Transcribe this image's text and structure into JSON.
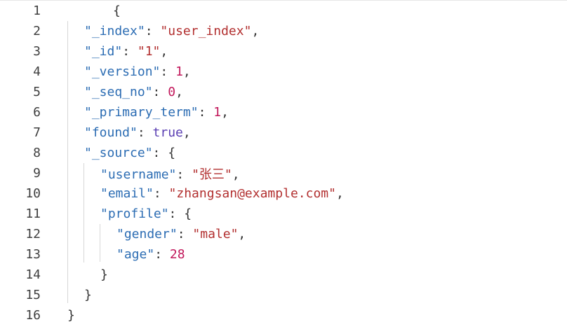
{
  "editor": {
    "lines": [
      {
        "n": "1",
        "t": "{"
      },
      {
        "n": "2",
        "t": "\"_index\": \"user_index\","
      },
      {
        "n": "3",
        "t": "\"_id\": \"1\","
      },
      {
        "n": "4",
        "t": "\"_version\": 1,"
      },
      {
        "n": "5",
        "t": "\"_seq_no\": 0,"
      },
      {
        "n": "6",
        "t": "\"_primary_term\": 1,"
      },
      {
        "n": "7",
        "t": "\"found\": true,"
      },
      {
        "n": "8",
        "t": "\"_source\": {"
      },
      {
        "n": "9",
        "t": "\"username\": \"张三\","
      },
      {
        "n": "10",
        "t": "\"email\": \"zhangsan@example.com\","
      },
      {
        "n": "11",
        "t": "\"profile\": {"
      },
      {
        "n": "12",
        "t": "\"gender\": \"male\","
      },
      {
        "n": "13",
        "t": "\"age\": 28"
      },
      {
        "n": "14",
        "t": "}"
      },
      {
        "n": "15",
        "t": "}"
      },
      {
        "n": "16",
        "t": "}"
      }
    ],
    "colors": {
      "key": "#2b6cb3",
      "string": "#b22f2f",
      "number": "#c2185b",
      "boolean": "#5b3fb3"
    }
  },
  "tokens": {
    "l1": {
      "open": "{"
    },
    "l2": {
      "k": "\"_index\"",
      "colon": ": ",
      "v": "\"user_index\"",
      "comma": ","
    },
    "l3": {
      "k": "\"_id\"",
      "colon": ": ",
      "v": "\"1\"",
      "comma": ","
    },
    "l4": {
      "k": "\"_version\"",
      "colon": ": ",
      "v": "1",
      "comma": ","
    },
    "l5": {
      "k": "\"_seq_no\"",
      "colon": ": ",
      "v": "0",
      "comma": ","
    },
    "l6": {
      "k": "\"_primary_term\"",
      "colon": ": ",
      "v": "1",
      "comma": ","
    },
    "l7": {
      "k": "\"found\"",
      "colon": ": ",
      "v": "true",
      "comma": ","
    },
    "l8": {
      "k": "\"_source\"",
      "colon": ": ",
      "v": "{"
    },
    "l9": {
      "k": "\"username\"",
      "colon": ": ",
      "v": "\"张三\"",
      "comma": ","
    },
    "l10": {
      "k": "\"email\"",
      "colon": ": ",
      "v": "\"zhangsan@example.com\"",
      "comma": ","
    },
    "l11": {
      "k": "\"profile\"",
      "colon": ": ",
      "v": "{"
    },
    "l12": {
      "k": "\"gender\"",
      "colon": ": ",
      "v": "\"male\"",
      "comma": ","
    },
    "l13": {
      "k": "\"age\"",
      "colon": ": ",
      "v": "28"
    },
    "l14": {
      "close": "}"
    },
    "l15": {
      "close": "}"
    },
    "l16": {
      "close": "}"
    }
  }
}
